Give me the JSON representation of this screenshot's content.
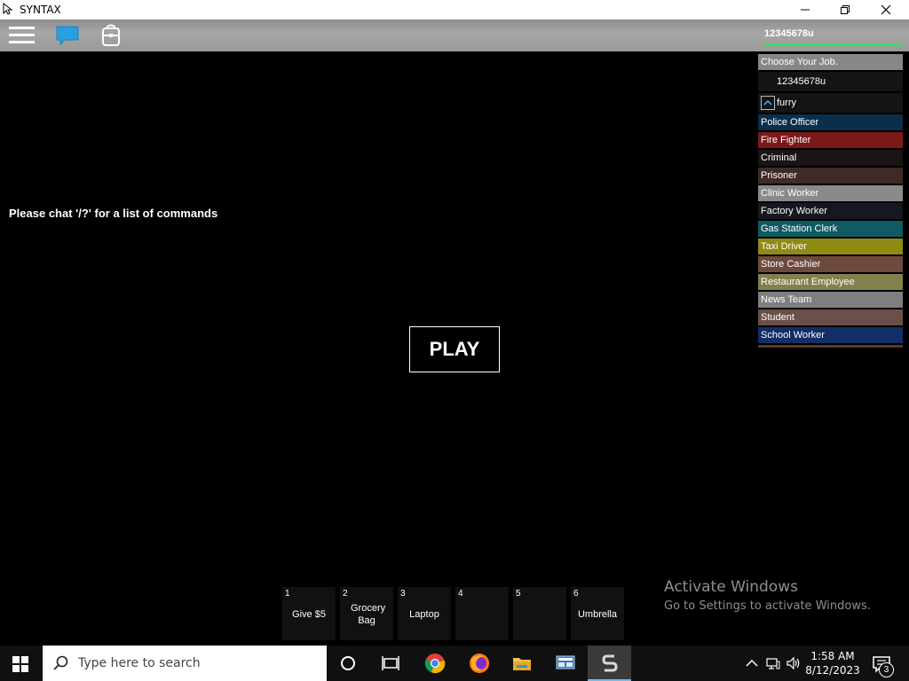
{
  "window": {
    "title": "SYNTAX"
  },
  "topbar": {
    "player_name": "12345678u",
    "health": 1.0
  },
  "hint_text": "Please chat '/?' for a list of commands",
  "play_label": "PLAY",
  "job_panel": {
    "header": "Choose Your Job.",
    "player": "12345678u",
    "team": "furry",
    "jobs": [
      {
        "label": "Police Officer",
        "color": "#0b2e4a"
      },
      {
        "label": "Fire Fighter",
        "color": "#7a1a18"
      },
      {
        "label": "Criminal",
        "color": "#1a1414"
      },
      {
        "label": "Prisoner",
        "color": "#3f2b26"
      },
      {
        "label": "Clinic Worker",
        "color": "#8a8a8a"
      },
      {
        "label": "Factory Worker",
        "color": "#141820"
      },
      {
        "label": "Gas Station Clerk",
        "color": "#0f5a63"
      },
      {
        "label": "Taxi Driver",
        "color": "#8f8a12"
      },
      {
        "label": "Store Cashier",
        "color": "#6e4a3e"
      },
      {
        "label": "Restaurant Employee",
        "color": "#84804e"
      },
      {
        "label": "News Team",
        "color": "#7f7f7f"
      },
      {
        "label": "Student",
        "color": "#6a5048"
      },
      {
        "label": "School Worker",
        "color": "#132d66"
      }
    ]
  },
  "hotbar": [
    {
      "num": "1",
      "label": "Give $5"
    },
    {
      "num": "2",
      "label": "Grocery Bag"
    },
    {
      "num": "3",
      "label": "Laptop"
    },
    {
      "num": "4",
      "label": ""
    },
    {
      "num": "5",
      "label": ""
    },
    {
      "num": "6",
      "label": "Umbrella"
    }
  ],
  "watermark": {
    "line1": "Activate Windows",
    "line2": "Go to Settings to activate Windows."
  },
  "taskbar": {
    "search_placeholder": "Type here to search",
    "time": "1:58 AM",
    "date": "8/12/2023",
    "notification_count": "3"
  }
}
